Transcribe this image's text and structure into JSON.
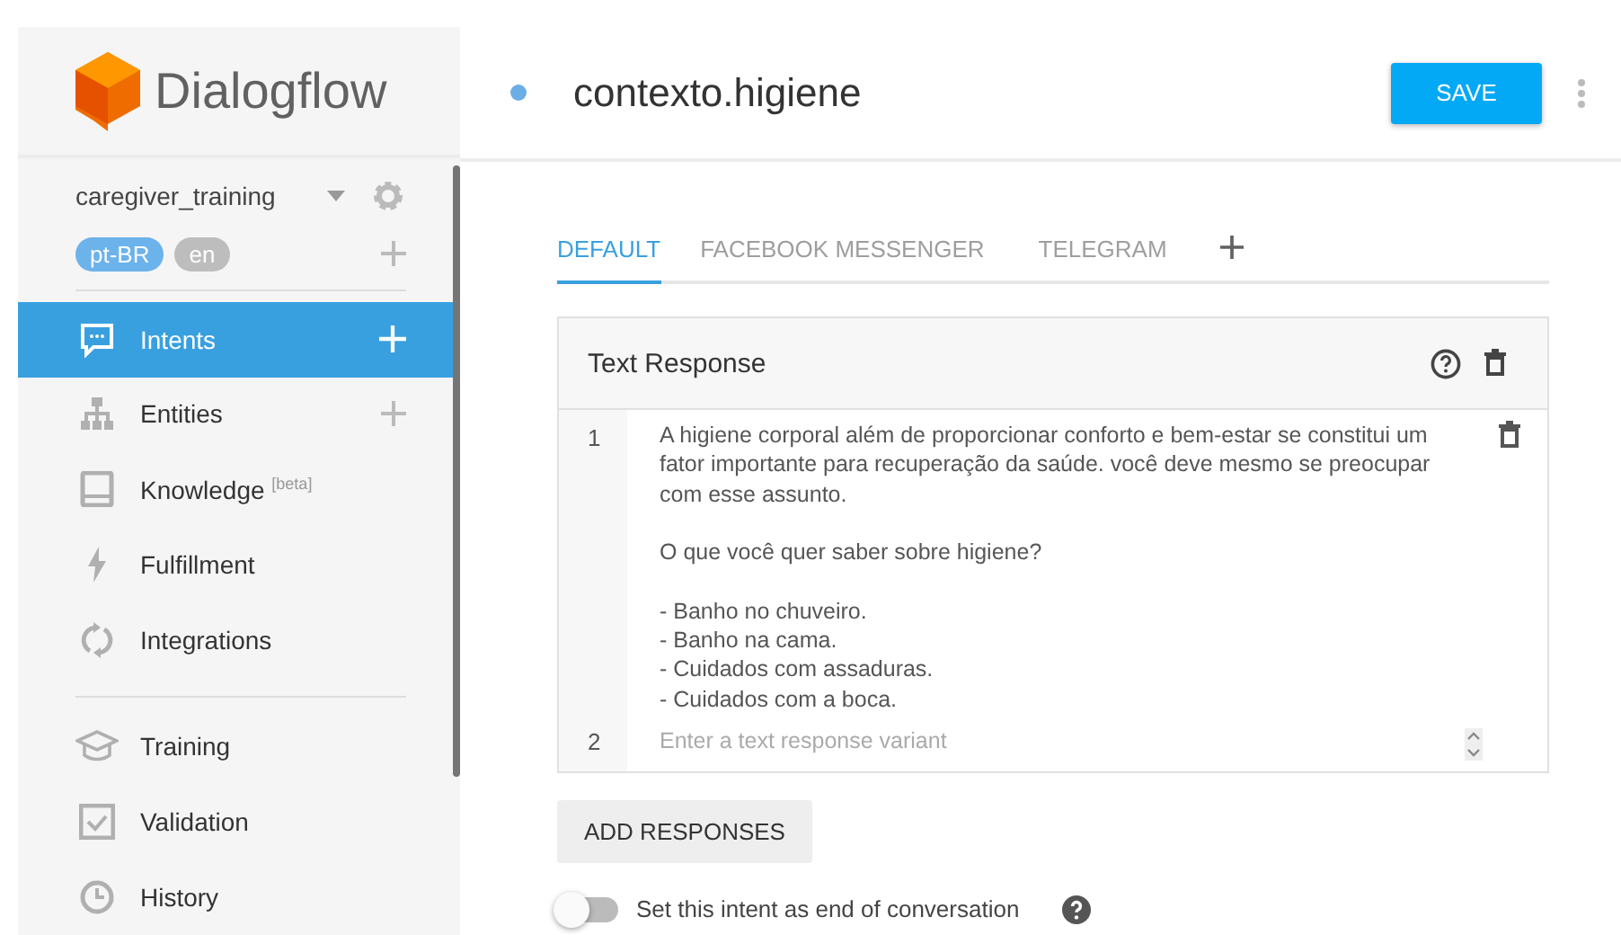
{
  "logo": {
    "name": "Dialogflow"
  },
  "agent": {
    "name": "caregiver_training",
    "languages": [
      {
        "code": "pt-BR",
        "selected": true
      },
      {
        "code": "en",
        "selected": false
      }
    ]
  },
  "nav": [
    [
      {
        "label": "Intents",
        "selected": true,
        "add": true
      },
      {
        "label": "Entities",
        "selected": false,
        "add": true
      },
      {
        "label": "Knowledge $^{[beta]}$",
        "selected": false,
        "add": false
      },
      {
        "label": "Fulfillment",
        "selected": false,
        "add": false
      },
      {
        "label": "Integrations",
        "selected": false,
        "add": false
      }
    ],
    [
      {
        "label": "Training",
        "selected": false,
        "add": false
      },
      {
        "label": "Validation",
        "selected": false,
        "add": false
      },
      {
        "label": "History",
        "selected": false,
        "add": false
      }
    ]
  ],
  "intent": {
    "title": "contexto.higiene",
    "save": "SAVE"
  },
  "tabs": [
    {
      "label": "DEFAULT",
      "selected": true
    },
    {
      "label": "FACEBOOK MESSENGER",
      "selected": false
    },
    {
      "label": "TELEGRAM",
      "selected": false
    }
  ],
  "response_card": {
    "title": "Text Response",
    "rows": [
      {
        "number": "1",
        "value": "A higiene corporal além de proporcionar conforto e bem-estar se constitui um fator importante para recuperação da saúde. você deve mesmo se preocupar com esse assunto.\n\nO que você quer saber sobre higiene?\n\n- Banho no chuveiro.\n- Banho na cama.\n- Cuidados com assaduras.\n- Cuidados com a boca."
      },
      {
        "number": "2",
        "placeholder": "Enter a text response variant"
      }
    ]
  },
  "add_responses": "ADD RESPONSES",
  "end_of_conversation": {
    "label": "Set this intent as end of conversation",
    "on": false
  }
}
